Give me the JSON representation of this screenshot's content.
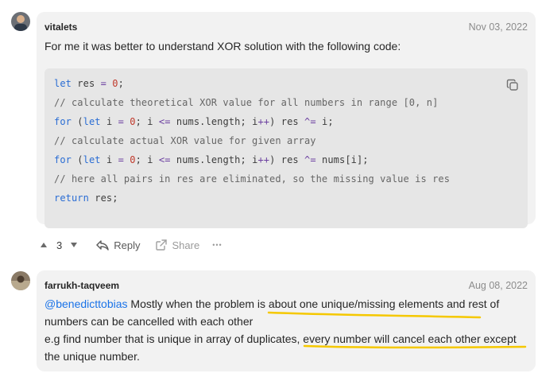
{
  "comments": [
    {
      "author": "vitalets",
      "date": "Nov 03, 2022",
      "text": "For me it was better to understand XOR solution with the following code:",
      "code": {
        "line1": {
          "kw": "let",
          "rest1": " res ",
          "op": "=",
          "rest2": " ",
          "num": "0",
          "end": ";"
        },
        "line2": "// calculate theoretical XOR value for all numbers in range [0, n]",
        "line3": {
          "kw1": "for",
          "p1": " (",
          "kw2": "let",
          "p2": " i ",
          "op1": "=",
          "p3": " ",
          "num": "0",
          "p4": "; i ",
          "op2": "<=",
          "p5": " nums.length; i",
          "op3": "++",
          "p6": ") res ",
          "op4": "^=",
          "p7": " i;"
        },
        "line4": "// calculate actual XOR value for given array",
        "line5": {
          "kw1": "for",
          "p1": " (",
          "kw2": "let",
          "p2": " i ",
          "op1": "=",
          "p3": " ",
          "num": "0",
          "p4": "; i ",
          "op2": "<=",
          "p5": " nums.length; i",
          "op3": "++",
          "p6": ") res ",
          "op4": "^=",
          "p7": " nums[i];"
        },
        "line6": "// here all pairs in res are eliminated, so the missing value is res",
        "line7": {
          "kw": "return",
          "rest": " res;"
        }
      },
      "actions": {
        "upvotes": "3",
        "reply": "Reply",
        "share": "Share",
        "more": "•••"
      }
    },
    {
      "author": "farrukh-taqveem",
      "date": "Aug 08, 2022",
      "line1_mention": "@benedicttobias",
      "line1_rest": " Mostly when the problem is about one unique/missing elements and rest of",
      "line2": "numbers can be cancelled with each other",
      "line3": "e.g find number that is unique in array of duplicates, every number will cancel each other except",
      "line4": "the unique number."
    }
  ],
  "colors": {
    "card_bg": "#f2f2f2",
    "code_bg": "#e6e6e6",
    "keyword": "#2a6dd4",
    "number": "#c0392b",
    "mention": "#1a73e8",
    "highlight": "#f5c800"
  }
}
